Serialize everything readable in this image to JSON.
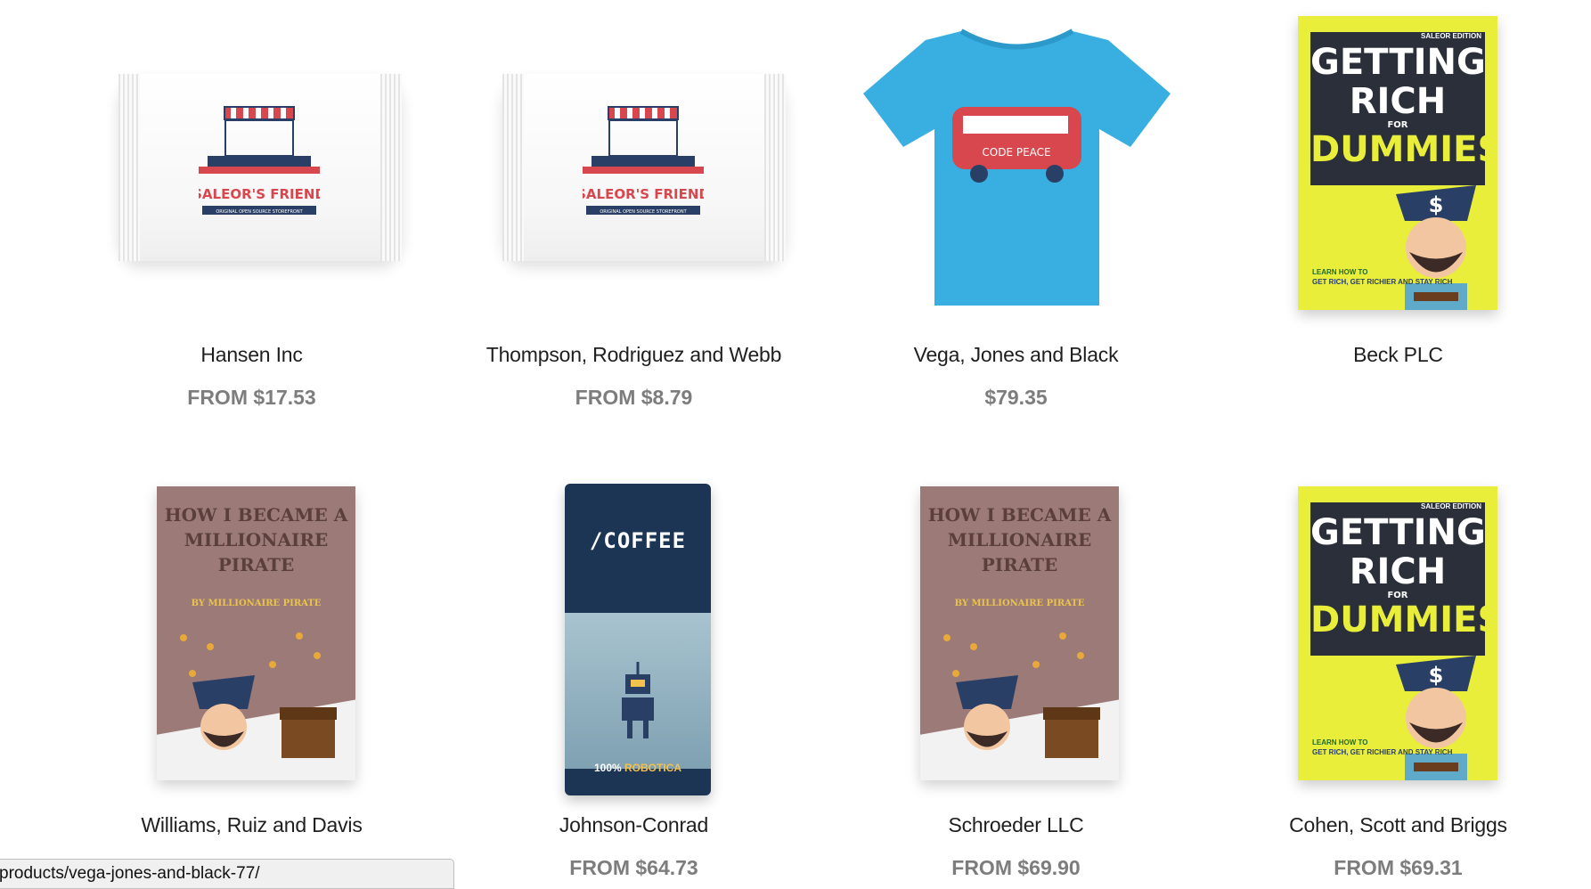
{
  "products": [
    {
      "name": "Hansen Inc",
      "price": "FROM $17.53",
      "image": "candy-pouch"
    },
    {
      "name": "Thompson, Rodriguez and Webb",
      "price": "FROM $8.79",
      "image": "candy-pouch"
    },
    {
      "name": "Vega, Jones and Black",
      "price": "$79.35",
      "image": "tshirt"
    },
    {
      "name": "Beck PLC",
      "price": "",
      "image": "book-getting-rich"
    },
    {
      "name": "Williams, Ruiz and Davis",
      "price": "",
      "image": "book-pirate"
    },
    {
      "name": "Johnson-Conrad",
      "price": "FROM $64.73",
      "image": "coffee-bag"
    },
    {
      "name": "Schroeder LLC",
      "price": "FROM $69.90",
      "image": "book-pirate"
    },
    {
      "name": "Cohen, Scott and Briggs",
      "price": "FROM $69.31",
      "image": "book-getting-rich"
    }
  ],
  "artwork": {
    "pouch_brand": "SALEOR'S FRIEND",
    "pouch_tagline": "ORIGINAL OPEN SOURCE STOREFRONT",
    "shirt_text": "CODE PEACE",
    "book_yellow_edition": "SALEOR EDITION",
    "book_yellow_line1": "GETTING",
    "book_yellow_line2": "RICH",
    "book_yellow_for": "FOR",
    "book_yellow_line3": "DUMMIES",
    "book_yellow_learn": "LEARN HOW TO",
    "book_yellow_learn_desc": "GET RICH, GET RICHIER AND STAY RICH",
    "book_pink_title": "HOW I BECAME A MILLIONAIRE PIRATE",
    "book_pink_by": "BY MILLIONAIRE PIRATE",
    "coffee_label": "/COFFEE",
    "coffee_100": "100%",
    "coffee_robotica": "ROBOTICA"
  },
  "status_bar": {
    "url": "products/vega-jones-and-black-77/"
  },
  "colors": {
    "text": "#1f1f1f",
    "price": "#7d7d7d",
    "book_yellow": "#e9ee3a",
    "book_pink": "#9c7a78",
    "coffee_bag": "#1d3555",
    "shirt": "#39aee0"
  }
}
